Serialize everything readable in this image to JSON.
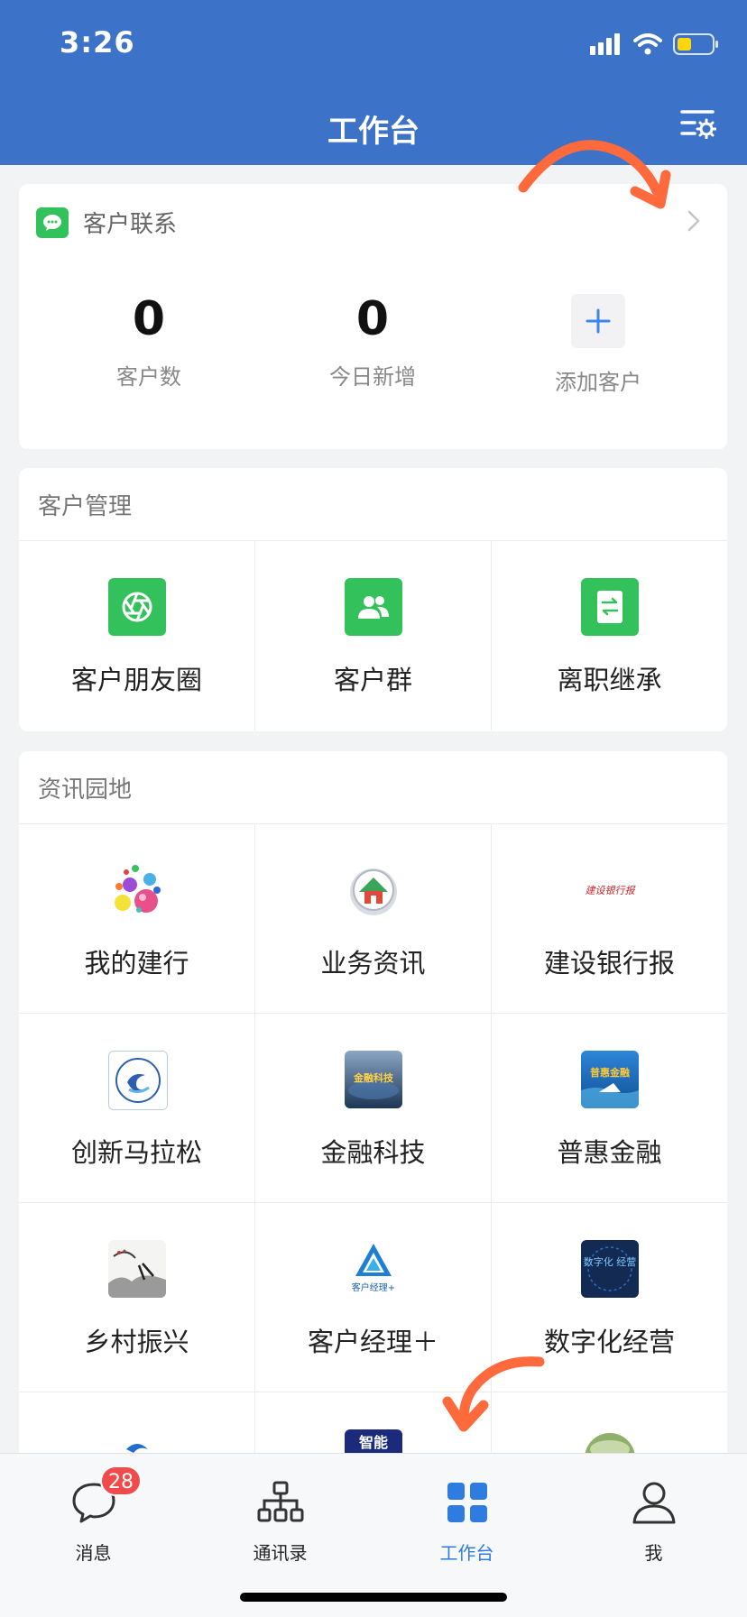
{
  "status_bar": {
    "time": "3:26"
  },
  "header": {
    "title": "工作台"
  },
  "contact_card": {
    "title": "客户联系",
    "stats": [
      {
        "value": "0",
        "label": "客户数"
      },
      {
        "value": "0",
        "label": "今日新增"
      }
    ],
    "add_label": "添加客户"
  },
  "customer_management": {
    "title": "客户管理",
    "items": [
      {
        "label": "客户朋友圈",
        "icon": "moments-icon"
      },
      {
        "label": "客户群",
        "icon": "group-icon"
      },
      {
        "label": "离职继承",
        "icon": "transfer-icon"
      }
    ]
  },
  "info_garden": {
    "title": "资讯园地",
    "items": [
      {
        "label": "我的建行",
        "icon": "bubbles-icon"
      },
      {
        "label": "业务资讯",
        "icon": "house-badge-icon"
      },
      {
        "label": "建设银行报",
        "icon": "newspaper-icon",
        "icon_text": "建设银行报"
      },
      {
        "label": "创新马拉松",
        "icon": "marathon-icon"
      },
      {
        "label": "金融科技",
        "icon": "fintech-icon",
        "icon_text": "金融科技"
      },
      {
        "label": "普惠金融",
        "icon": "inclusive-finance-icon",
        "icon_text": "普惠金融"
      },
      {
        "label": "乡村振兴",
        "icon": "ink-painting-icon"
      },
      {
        "label": "客户经理＋",
        "icon": "account-manager-icon",
        "icon_text": "客户经理+"
      },
      {
        "label": "数字化经营",
        "icon": "digital-ops-icon",
        "icon_text": "数字化 经营"
      }
    ],
    "partial_row_icons": [
      "blue-swirl-icon",
      "zhineng-icon",
      "globe-icon"
    ],
    "partial_row_icon_text": [
      "",
      "智能",
      ""
    ]
  },
  "tabbar": {
    "items": [
      {
        "label": "消息",
        "icon": "message-icon",
        "badge": "28"
      },
      {
        "label": "通讯录",
        "icon": "contacts-icon"
      },
      {
        "label": "工作台",
        "icon": "workbench-icon",
        "active": true
      },
      {
        "label": "我",
        "icon": "person-icon"
      }
    ]
  },
  "colors": {
    "header_bg": "#3c72c8",
    "accent_green": "#33c15b",
    "active_tab": "#2f7ce0",
    "badge_red": "#f04a4a",
    "annotation_arrow": "#ff6a3d"
  }
}
